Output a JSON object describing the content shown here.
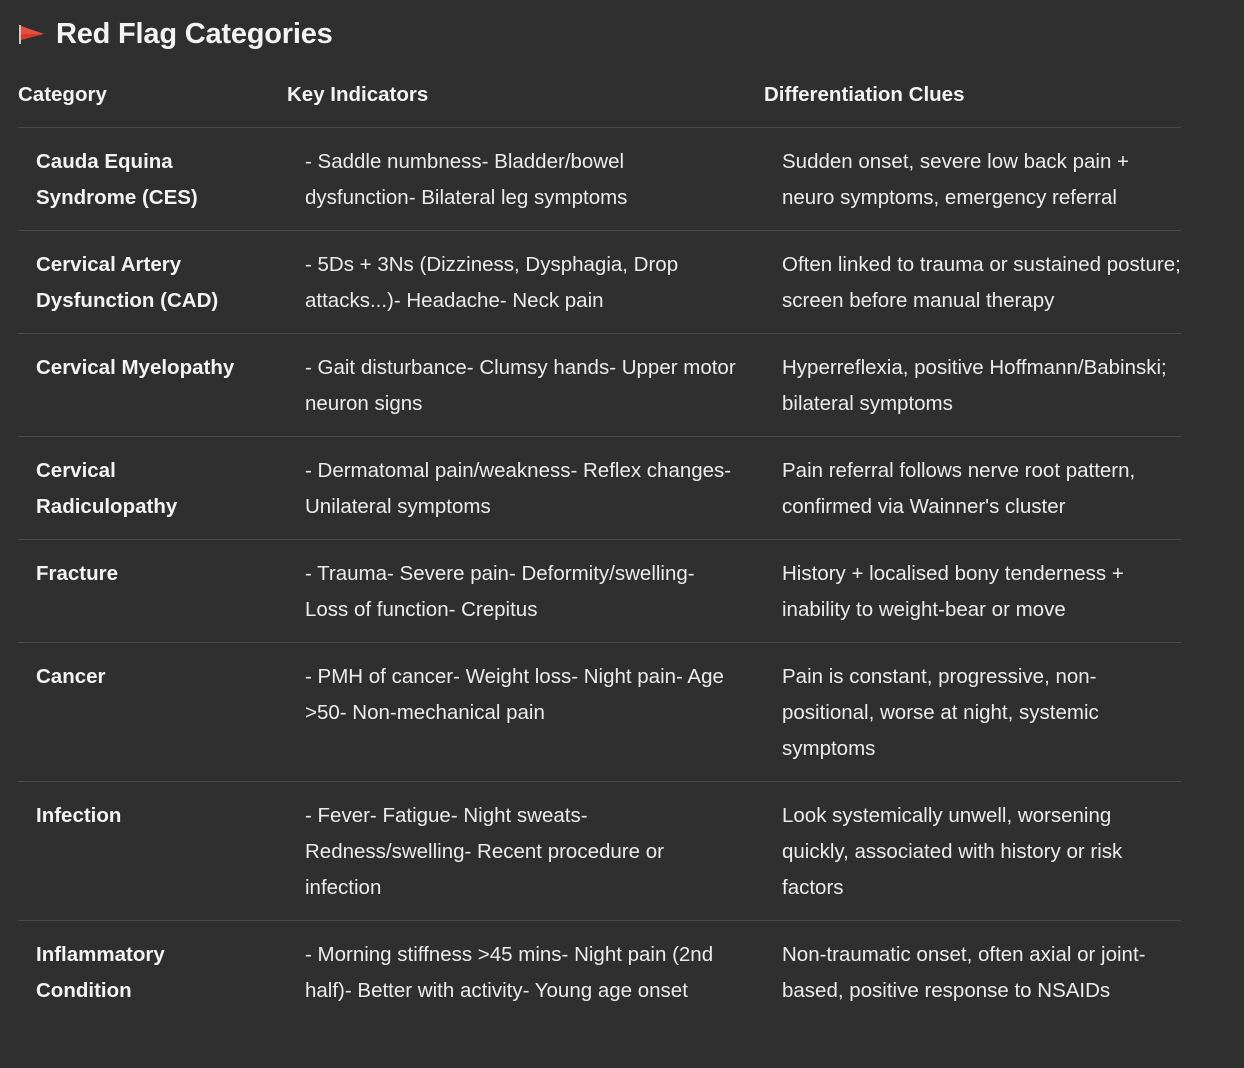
{
  "title": "Red Flag Categories",
  "icons": {
    "title_icon": "red-flag-icon",
    "flag_color": "#d93a2b"
  },
  "table": {
    "headers": [
      "Category",
      "Key Indicators",
      "Differentiation Clues"
    ],
    "rows": [
      {
        "category": "Cauda Equina Syndrome (CES)",
        "indicators": "- Saddle numbness- Bladder/bowel dysfunction- Bilateral leg symptoms",
        "clues": "Sudden onset, severe low back pain + neuro symptoms, emergency referral"
      },
      {
        "category": "Cervical Artery Dysfunction (CAD)",
        "indicators": "- 5Ds + 3Ns (Dizziness, Dysphagia, Drop attacks...)- Headache- Neck pain",
        "clues": "Often linked to trauma or sustained posture; screen before manual therapy"
      },
      {
        "category": "Cervical Myelopathy",
        "indicators": "- Gait disturbance- Clumsy hands- Upper motor neuron signs",
        "clues": "Hyperreflexia, positive Hoffmann/Babinski; bilateral symptoms"
      },
      {
        "category": "Cervical Radiculopathy",
        "indicators": "- Dermatomal pain/weakness- Reflex changes- Unilateral symptoms",
        "clues": "Pain referral follows nerve root pattern, confirmed via Wainner's cluster"
      },
      {
        "category": "Fracture",
        "indicators": "- Trauma- Severe pain- Deformity/swelling- Loss of function- Crepitus",
        "clues": "History + localised bony tenderness + inability to weight-bear or move"
      },
      {
        "category": "Cancer",
        "indicators": "- PMH of cancer- Weight loss- Night pain- Age >50- Non-mechanical pain",
        "clues": "Pain is constant, progressive, non-positional, worse at night, systemic symptoms"
      },
      {
        "category": "Infection",
        "indicators": "- Fever- Fatigue- Night sweats- Redness/swelling- Recent procedure or infection",
        "clues": "Look systemically unwell, worsening quickly, associated with history or risk factors"
      },
      {
        "category": "Inflammatory Condition",
        "indicators": "- Morning stiffness >45 mins- Night pain (2nd half)- Better with activity- Young age onset",
        "clues": "Non-traumatic onset, often axial or joint-based, positive response to NSAIDs"
      }
    ]
  }
}
